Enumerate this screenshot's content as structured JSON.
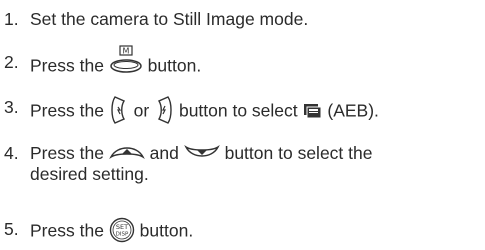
{
  "steps": [
    {
      "number": "1.",
      "text": "Set the camera to Still Image mode."
    },
    {
      "number": "2.",
      "pre": "Press the ",
      "post": " button.",
      "icon": "menu-button-icon",
      "icon_label": "M"
    },
    {
      "number": "3.",
      "pre": "Press the ",
      "mid": " or ",
      "post": " button to select ",
      "tail": " (AEB).",
      "icons": [
        "left-flash-button-icon",
        "right-button-icon",
        "aeb-mode-icon"
      ]
    },
    {
      "number": "4.",
      "pre": "Press the ",
      "mid": " and ",
      "post": " button to select the",
      "line2": "desired setting.",
      "icons": [
        "up-button-icon",
        "down-button-icon"
      ]
    },
    {
      "number": "5.",
      "pre": "Press the ",
      "post": " button.",
      "icon": "set-disp-button-icon",
      "icon_label_top": "SET",
      "icon_label_bottom": "DISP"
    }
  ]
}
